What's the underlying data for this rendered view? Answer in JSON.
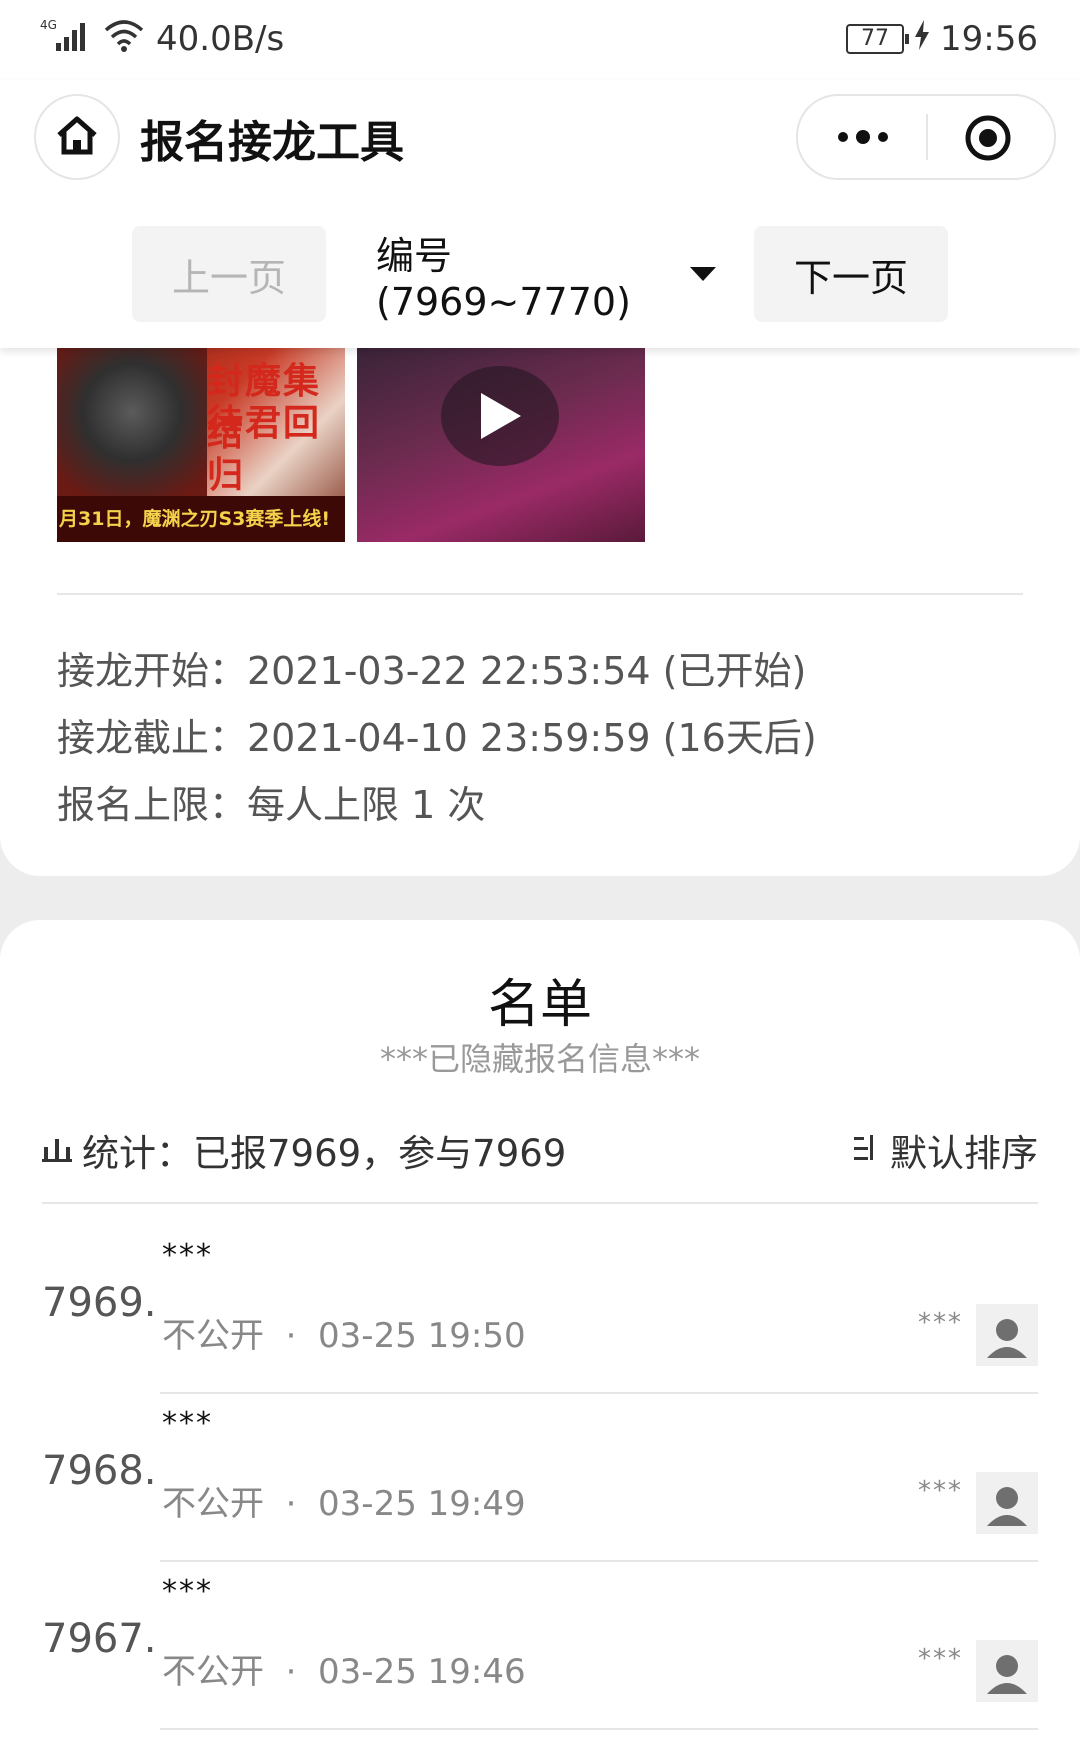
{
  "status_bar": {
    "network": "4G",
    "speed": "40.0B/s",
    "battery": "77",
    "time": "19:56"
  },
  "nav": {
    "title": "报名接龙工具"
  },
  "pager": {
    "prev_label": "上一页",
    "range_label": "编号(7969~7770)",
    "next_label": "下一页"
  },
  "media": {
    "banner_line1": "封魔集结",
    "banner_line2": "待君回归",
    "banner_strip": "月31日，魔渊之刃S3赛季上线!"
  },
  "info": {
    "start": "接龙开始：2021-03-22 22:53:54 (已开始)",
    "end": "接龙截止：2021-04-10 23:59:59 (16天后)",
    "limit": "报名上限：每人上限 1 次"
  },
  "list": {
    "title": "名单",
    "subtitle": "***已隐藏报名信息***",
    "stats": "统计：已报7969，参与7969",
    "sort_label": "默认排序",
    "entries": [
      {
        "num": "7969.",
        "name": "***",
        "privacy": "不公开",
        "time": "03-25 19:50",
        "mask": "***"
      },
      {
        "num": "7968.",
        "name": "***",
        "privacy": "不公开",
        "time": "03-25 19:49",
        "mask": "***"
      },
      {
        "num": "7967.",
        "name": "***",
        "privacy": "不公开",
        "time": "03-25 19:46",
        "mask": "***"
      }
    ]
  },
  "colors": {
    "background": "#ededed",
    "card": "#ffffff",
    "text_primary": "#111111",
    "text_secondary": "#888888",
    "disabled": "#b5b5b5"
  }
}
